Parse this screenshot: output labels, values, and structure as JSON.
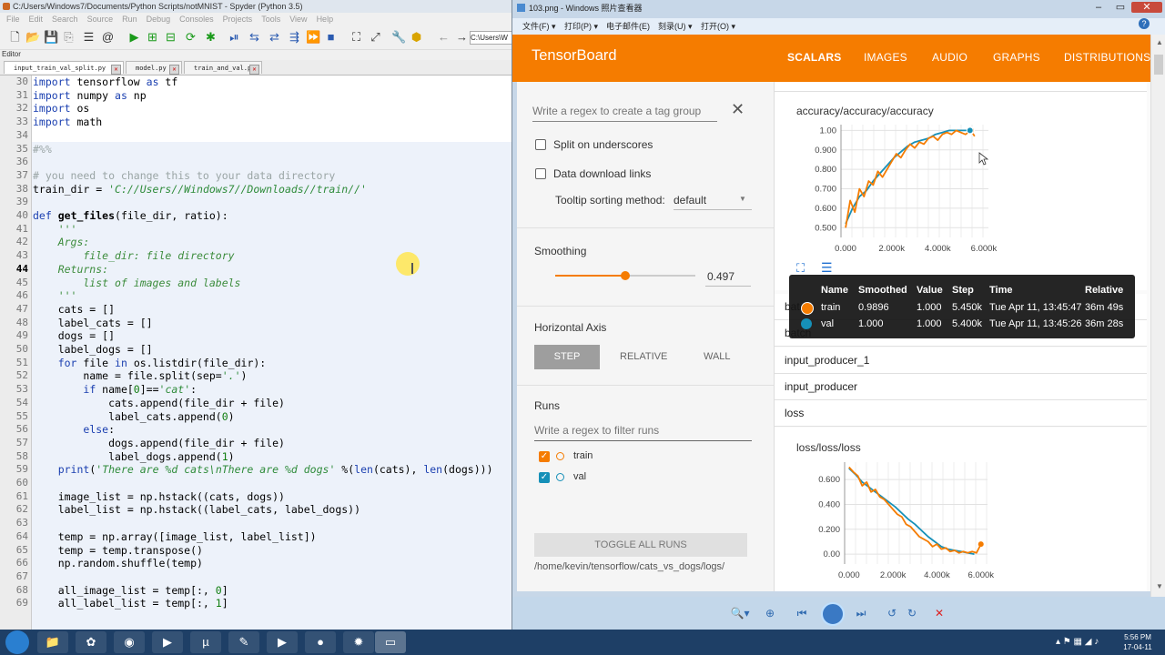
{
  "spyder": {
    "title": "C:/Users/Windows7/Documents/Python Scripts/notMNIST - Spyder (Python 3.5)",
    "menu": [
      "File",
      "Edit",
      "Search",
      "Source",
      "Run",
      "Debug",
      "Consoles",
      "Projects",
      "Tools",
      "View",
      "Help"
    ],
    "path_box": "C:\\Users\\W",
    "editor_label": "Editor",
    "tabs": [
      "input_train_val_split.py",
      "model.py",
      "train_and_val.py"
    ],
    "line_numbers": [
      "30",
      "31",
      "32",
      "33",
      "34",
      "35",
      "36",
      "37",
      "38",
      "39",
      "40",
      "41",
      "42",
      "43",
      "44",
      "45",
      "46",
      "47",
      "48",
      "49",
      "50",
      "51",
      "52",
      "53",
      "54",
      "55",
      "56",
      "57",
      "58",
      "59",
      "60",
      "61",
      "62",
      "63",
      "64",
      "65",
      "66",
      "67",
      "68",
      "69"
    ],
    "current_line": "44"
  },
  "viewer": {
    "title": "103.png - Windows 照片查看器",
    "menu": [
      "文件(F) ▾",
      "打印(P) ▾",
      "电子邮件(E)",
      "刻录(U) ▾",
      "打开(O) ▾"
    ],
    "help": "?"
  },
  "tensorboard": {
    "logo": "TensorBoard",
    "nav": [
      "SCALARS",
      "IMAGES",
      "AUDIO",
      "GRAPHS",
      "DISTRIBUTIONS"
    ],
    "tag_regex_placeholder": "Write a regex to create a tag group",
    "split_underscores": "Split on underscores",
    "data_download": "Data download links",
    "tooltip_sort_label": "Tooltip sorting method:",
    "tooltip_sort_value": "default",
    "smoothing_label": "Smoothing",
    "smoothing_value": "0.497",
    "smoothing_fraction": 0.497,
    "horizontal_axis_label": "Horizontal Axis",
    "axis_options": [
      "STEP",
      "RELATIVE",
      "WALL"
    ],
    "runs_label": "Runs",
    "runs_filter_placeholder": "Write a regex to filter runs",
    "runs": [
      {
        "name": "train",
        "color": "#f57c00",
        "checked": true
      },
      {
        "name": "val",
        "color": "#1690b8",
        "checked": true
      }
    ],
    "toggle_all": "TOGGLE ALL RUNS",
    "logdir": "/home/kevin/tensorflow/cats_vs_dogs/logs/",
    "rows": [
      "batch",
      "batch",
      "input_producer_1",
      "input_producer",
      "loss"
    ],
    "tooltip": {
      "headers": [
        "Name",
        "Smoothed",
        "Value",
        "Step",
        "Time",
        "Relative"
      ],
      "rows": [
        {
          "name": "train",
          "smoothed": "0.9896",
          "value": "1.000",
          "step": "5.450k",
          "time": "Tue Apr 11, 13:45:47",
          "relative": "36m 49s",
          "color": "#f57c00"
        },
        {
          "name": "val",
          "smoothed": "1.000",
          "value": "1.000",
          "step": "5.400k",
          "time": "Tue Apr 11, 13:45:26",
          "relative": "36m 28s",
          "color": "#1690b8"
        }
      ]
    }
  },
  "chart_data": [
    {
      "type": "line",
      "title": "accuracy/accuracy/accuracy",
      "xlabel": "",
      "ylabel": "",
      "xlim": [
        -200,
        6200
      ],
      "ylim": [
        0.45,
        1.03
      ],
      "x_ticks": [
        0,
        2000,
        4000,
        6000
      ],
      "x_tick_labels": [
        "0.000",
        "2.000k",
        "4.000k",
        "6.000k"
      ],
      "y_ticks": [
        0.5,
        0.6,
        0.7,
        0.8,
        0.9,
        1.0
      ],
      "y_tick_labels": [
        "0.500",
        "0.600",
        "0.700",
        "0.800",
        "0.900",
        "1.00"
      ],
      "grid": true,
      "series": [
        {
          "name": "train",
          "color": "#f57c00",
          "x": [
            0,
            200,
            400,
            600,
            800,
            1000,
            1200,
            1400,
            1600,
            1800,
            2000,
            2200,
            2400,
            2600,
            2800,
            3000,
            3200,
            3400,
            3600,
            3800,
            4000,
            4200,
            4400,
            4600,
            4800,
            5000,
            5200,
            5450,
            5600
          ],
          "y": [
            0.5,
            0.64,
            0.58,
            0.7,
            0.66,
            0.74,
            0.72,
            0.79,
            0.76,
            0.8,
            0.84,
            0.88,
            0.86,
            0.9,
            0.93,
            0.91,
            0.94,
            0.93,
            0.96,
            0.97,
            0.95,
            0.98,
            0.99,
            0.98,
            1.0,
            0.99,
            0.98,
            1.0,
            0.97
          ]
        },
        {
          "name": "val",
          "color": "#1690b8",
          "x": [
            0,
            300,
            600,
            900,
            1200,
            1500,
            1800,
            2100,
            2400,
            2700,
            3000,
            3300,
            3600,
            3900,
            4200,
            4500,
            4800,
            5100,
            5400
          ],
          "y": [
            0.52,
            0.6,
            0.66,
            0.69,
            0.74,
            0.78,
            0.82,
            0.86,
            0.89,
            0.92,
            0.94,
            0.95,
            0.96,
            0.98,
            0.99,
            1.0,
            1.0,
            1.0,
            1.0
          ]
        }
      ]
    },
    {
      "type": "line",
      "title": "loss/loss/loss",
      "xlabel": "",
      "ylabel": "",
      "xlim": [
        -200,
        6300
      ],
      "ylim": [
        -0.08,
        0.74
      ],
      "x_ticks": [
        0,
        2000,
        4000,
        6000
      ],
      "x_tick_labels": [
        "0.000",
        "2.000k",
        "4.000k",
        "6.000k"
      ],
      "y_ticks": [
        0.0,
        0.2,
        0.4,
        0.6
      ],
      "y_tick_labels": [
        "0.00",
        "0.200",
        "0.400",
        "0.600"
      ],
      "grid": true,
      "series": [
        {
          "name": "train",
          "color": "#f57c00",
          "x": [
            0,
            200,
            400,
            600,
            800,
            1000,
            1200,
            1400,
            1600,
            1800,
            2000,
            2200,
            2400,
            2600,
            2800,
            3000,
            3200,
            3400,
            3600,
            3800,
            4000,
            4200,
            4400,
            4600,
            4800,
            5000,
            5200,
            5400,
            5600,
            5800,
            6000
          ],
          "y": [
            0.7,
            0.66,
            0.63,
            0.55,
            0.58,
            0.5,
            0.52,
            0.46,
            0.44,
            0.4,
            0.36,
            0.32,
            0.3,
            0.24,
            0.22,
            0.18,
            0.14,
            0.12,
            0.1,
            0.06,
            0.08,
            0.04,
            0.05,
            0.02,
            0.03,
            0.01,
            0.02,
            0.01,
            0.02,
            0.01,
            0.08
          ]
        },
        {
          "name": "val",
          "color": "#1690b8",
          "x": [
            0,
            300,
            600,
            900,
            1200,
            1500,
            1800,
            2100,
            2400,
            2700,
            3000,
            3300,
            3600,
            3900,
            4200,
            4500,
            4800,
            5100,
            5400,
            5700
          ],
          "y": [
            0.69,
            0.64,
            0.58,
            0.54,
            0.5,
            0.46,
            0.42,
            0.38,
            0.33,
            0.28,
            0.24,
            0.19,
            0.14,
            0.1,
            0.06,
            0.04,
            0.03,
            0.02,
            0.01,
            0.0
          ]
        }
      ]
    }
  ],
  "taskbar": {
    "clock_time": "5:56 PM",
    "clock_date": "17-04-11"
  }
}
